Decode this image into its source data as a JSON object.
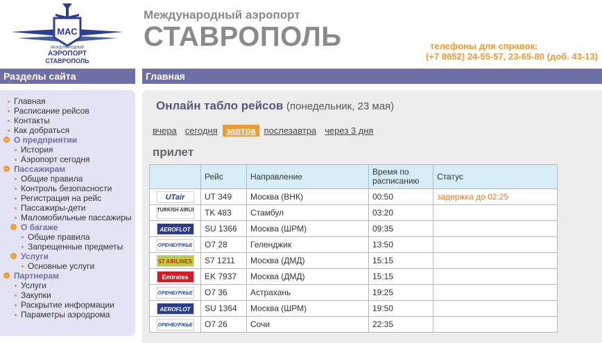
{
  "header": {
    "subtitle": "Международный аэропорт",
    "title": "СТАВРОПОЛЬ",
    "phones_label": "телефоны для справок:",
    "phones_value": "(+7 8652) 24-55-57, 23-65-80 (доб. 43-13)",
    "logo_mac": "МАС",
    "logo_line1": "АЭРОПОРТ",
    "logo_line2": "СТАВРОПОЛЬ",
    "logo_small": "МЕЖДУНАРОДНЫЙ"
  },
  "sidebar": {
    "title": "Разделы сайта",
    "items": [
      {
        "label": "Главная",
        "level": 1,
        "section": false,
        "key": "home"
      },
      {
        "label": "Расписание рейсов",
        "level": 1,
        "section": false,
        "key": "schedule"
      },
      {
        "label": "Контакты",
        "level": 1,
        "section": false,
        "key": "contacts"
      },
      {
        "label": "Как добраться",
        "level": 1,
        "section": false,
        "key": "how-to-get"
      },
      {
        "label": "О предприятии",
        "level": 1,
        "section": true,
        "key": "about"
      },
      {
        "label": "История",
        "level": 2,
        "section": false,
        "key": "history"
      },
      {
        "label": "Аэропорт сегодня",
        "level": 2,
        "section": false,
        "key": "airport-today"
      },
      {
        "label": "Пассажирам",
        "level": 1,
        "section": true,
        "key": "passengers"
      },
      {
        "label": "Общие правила",
        "level": 2,
        "section": false,
        "key": "general-rules"
      },
      {
        "label": "Контроль безопасности",
        "level": 2,
        "section": false,
        "key": "security-control"
      },
      {
        "label": "Регистрация на рейс",
        "level": 2,
        "section": false,
        "key": "check-in"
      },
      {
        "label": "Пассажиры-дети",
        "level": 2,
        "section": false,
        "key": "children"
      },
      {
        "label": "Маломобильные пассажиры",
        "level": 2,
        "section": false,
        "key": "reduced-mobility"
      },
      {
        "label": "О багаже",
        "level": 2,
        "section": true,
        "key": "baggage"
      },
      {
        "label": "Общие правила",
        "level": 3,
        "section": false,
        "key": "baggage-rules"
      },
      {
        "label": "Запрещенные предметы",
        "level": 3,
        "section": false,
        "key": "prohibited-items"
      },
      {
        "label": "Услуги",
        "level": 2,
        "section": true,
        "key": "services-section"
      },
      {
        "label": "Основные услуги",
        "level": 3,
        "section": false,
        "key": "main-services"
      },
      {
        "label": "Партнерам",
        "level": 1,
        "section": true,
        "key": "partners"
      },
      {
        "label": "Услуги",
        "level": 2,
        "section": false,
        "key": "partner-services"
      },
      {
        "label": "Закупки",
        "level": 2,
        "section": false,
        "key": "purchases"
      },
      {
        "label": "Раскрытие информации",
        "level": 2,
        "section": false,
        "key": "disclosure"
      },
      {
        "label": "Параметры аэродрома",
        "level": 2,
        "section": false,
        "key": "aerodrome-params"
      }
    ]
  },
  "main": {
    "bar_title": "Главная",
    "board_title": "Онлайн табло рейсов",
    "board_date": "(понедельник, 23 мая)",
    "day_tabs": [
      {
        "label": "вчера",
        "active": false,
        "key": "yesterday"
      },
      {
        "label": "сегодня",
        "active": false,
        "key": "today"
      },
      {
        "label": "завтра",
        "active": true,
        "key": "tomorrow"
      },
      {
        "label": "послезавтра",
        "active": false,
        "key": "day-after-tomorrow"
      },
      {
        "label": "через 3 дня",
        "active": false,
        "key": "in-3-days"
      }
    ],
    "section_title": "прилет",
    "table": {
      "headers": [
        "",
        "Рейс",
        "Направление",
        "Время по расписанию",
        "Статус"
      ],
      "rows": [
        {
          "airline": "utair",
          "logo_text": "UTair",
          "flight": "UT 349",
          "direction": "Москва (ВНК)",
          "time": "00:50",
          "status": "задержка до 02:25"
        },
        {
          "airline": "turkish",
          "logo_text": "TURKISH AIRLINES",
          "flight": "TK 483",
          "direction": "Стамбул",
          "time": "03:20",
          "status": ""
        },
        {
          "airline": "aeroflot",
          "logo_text": "AEROFLOT",
          "flight": "SU 1366",
          "direction": "Москва (ШРМ)",
          "time": "09:35",
          "status": ""
        },
        {
          "airline": "orenair",
          "logo_text": "ОРЕНБУРЖЬЕ",
          "flight": "O7 28",
          "direction": "Геленджик",
          "time": "13:50",
          "status": ""
        },
        {
          "airline": "s7",
          "logo_text": "S7 AIRLINES",
          "flight": "S7 1211",
          "direction": "Москва (ДМД)",
          "time": "15:15",
          "status": ""
        },
        {
          "airline": "emirates",
          "logo_text": "Emirates",
          "flight": "EK 7937",
          "direction": "Москва (ДМД)",
          "time": "15:15",
          "status": ""
        },
        {
          "airline": "orenair",
          "logo_text": "ОРЕНБУРЖЬЕ",
          "flight": "O7 36",
          "direction": "Астрахань",
          "time": "19:25",
          "status": ""
        },
        {
          "airline": "aeroflot",
          "logo_text": "AEROFLOT",
          "flight": "SU 1364",
          "direction": "Москва (ШРМ)",
          "time": "19:50",
          "status": ""
        },
        {
          "airline": "orenair",
          "logo_text": "ОРЕНБУРЖЬЕ",
          "flight": "O7 26",
          "direction": "Сочи",
          "time": "22:35",
          "status": ""
        }
      ]
    }
  },
  "colors": {
    "accent": "#f39a2c",
    "bar": "#6d6fa6",
    "sidebar_bg": "#e3e3f3",
    "table_header_bg": "#d6eef8"
  }
}
